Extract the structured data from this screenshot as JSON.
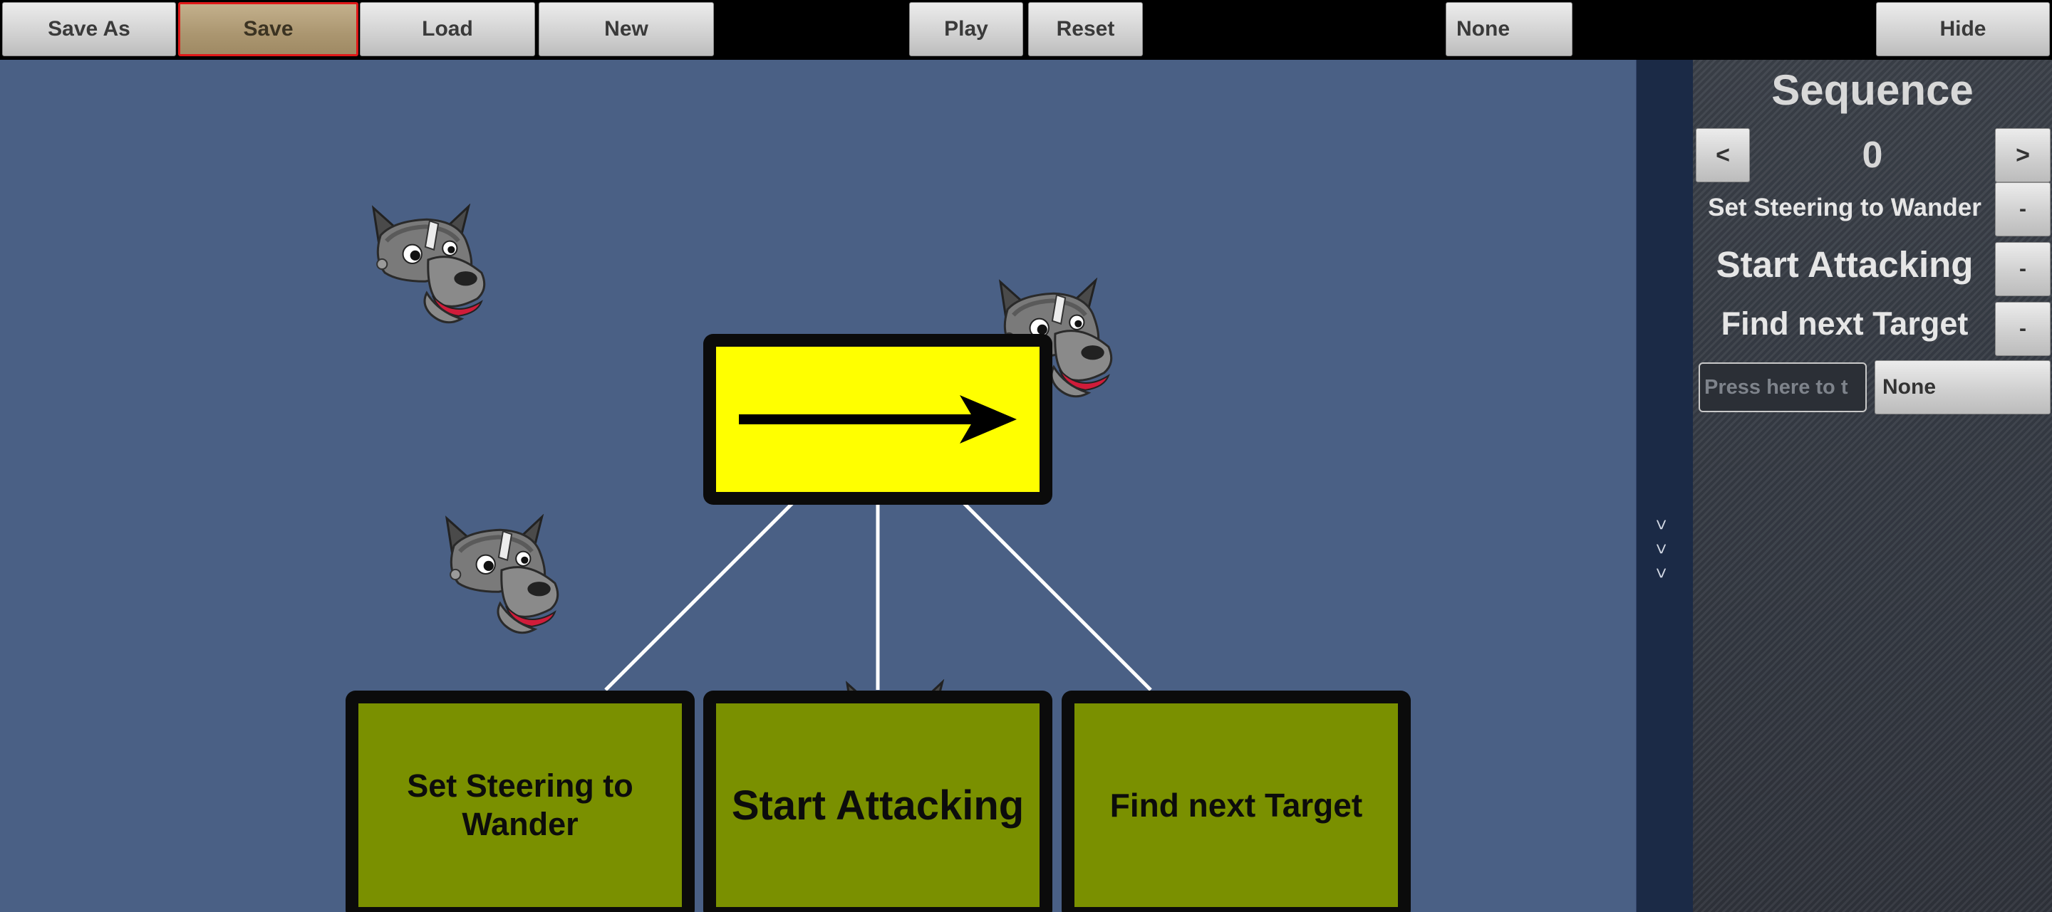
{
  "toolbar": {
    "save_as": "Save As",
    "save": "Save",
    "load": "Load",
    "new": "New",
    "play": "Play",
    "reset": "Reset",
    "selector": "None",
    "hide": "Hide"
  },
  "canvas": {
    "root_node_icon": "right-arrow-icon",
    "nodes": [
      "Set Steering to Wander",
      "Start Attacking",
      "Find next Target"
    ]
  },
  "collapse_strip": {
    "arrows": ">>>"
  },
  "panel": {
    "title": "Sequence",
    "prev": "<",
    "index": "0",
    "next": ">",
    "items": [
      "Set Steering to Wander",
      "Start Attacking",
      "Find next Target"
    ],
    "remove_label": "-",
    "input_placeholder": "Press here to t",
    "dropdown_value": "None"
  },
  "colors": {
    "canvas_bg": "#4a6085",
    "root_node": "#ffff00",
    "action_node": "#7a9000",
    "active_button_border": "#e01818"
  }
}
